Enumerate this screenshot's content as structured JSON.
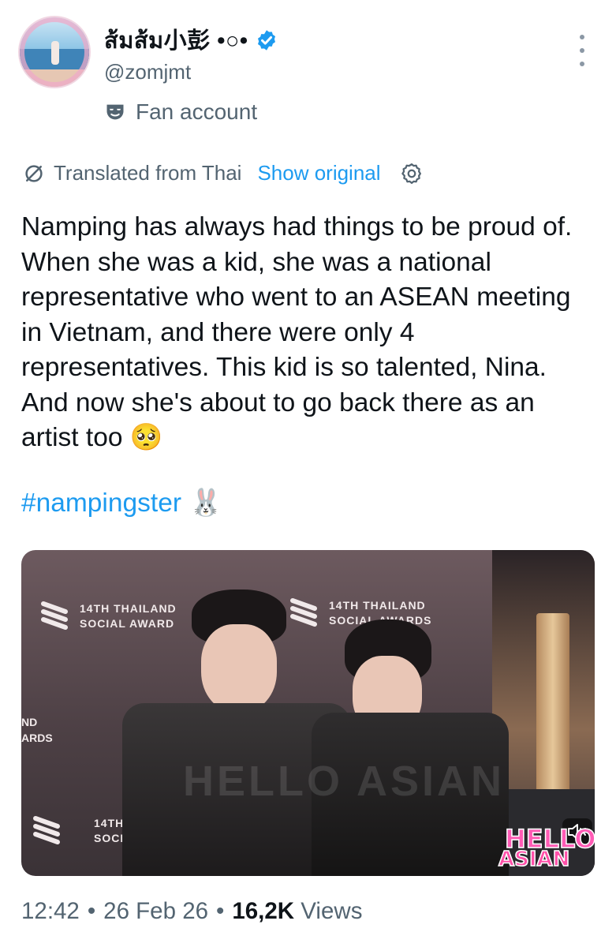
{
  "author": {
    "display_name": "ส้มส้ม小彭 •○•",
    "handle": "@zomjmt",
    "account_label": "Fan account",
    "verified_color": "#1d9bf0",
    "label_icon": "theater-mask-icon"
  },
  "translation": {
    "label": "Translated from Thai",
    "show_original": "Show original",
    "icon": "translate-slash-icon",
    "settings_icon": "gear-icon"
  },
  "tweet": {
    "text": "Namping has always had things to be proud of. When she was a kid, she was a national representative who went to an ASEAN meeting in Vietnam, and there were only 4 representatives. This kid is so talented, Nina. And now she's about to go back there as an artist too 🥺",
    "hashtag": "#nampingster",
    "hashtag_emoji": "🐰"
  },
  "media": {
    "backdrop_logo_lines": [
      "14TH THAILAND",
      "SOCIAL AWARD"
    ],
    "backdrop_logo_lines_b": [
      "14TH THAILAND",
      "SOCIAL AWARDS"
    ],
    "backdrop_logo_lines_c": [
      "14TH THA",
      "SOCIAL A"
    ],
    "side_text_lines": [
      "ND",
      "ARDS"
    ],
    "watermark": "HELLO ASIAN",
    "badge_top": "HELLO",
    "badge_bottom": "ASIAN"
  },
  "meta": {
    "time": "12:42",
    "date": "26 Feb 26",
    "views_count": "16,2K",
    "views_label": "Views",
    "separator": "•"
  },
  "colors": {
    "accent": "#1d9bf0",
    "secondary_text": "#536471",
    "primary_text": "#0f1419"
  }
}
